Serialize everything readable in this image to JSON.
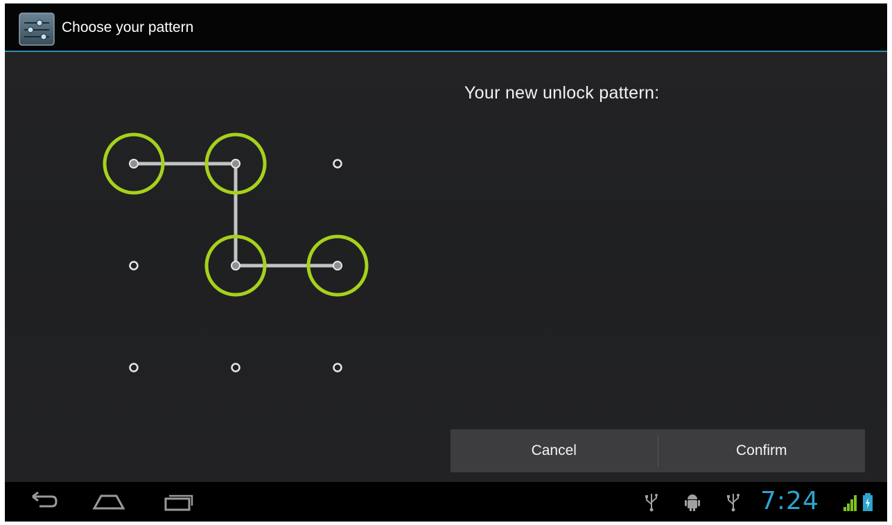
{
  "action_bar": {
    "title": "Choose your pattern",
    "icon": "settings-sliders-icon"
  },
  "pattern": {
    "grid_size": 3,
    "selected_sequence": [
      1,
      2,
      5,
      6
    ],
    "accent_color": "#a6d11b",
    "line_color": "#c4c4c4",
    "dot_color": "#e6e6e6"
  },
  "prompt": {
    "text": "Your new unlock pattern:"
  },
  "buttons": {
    "cancel_label": "Cancel",
    "confirm_label": "Confirm"
  },
  "nav_bar": {
    "back_icon": "back-arrow-icon",
    "home_icon": "home-icon",
    "recents_icon": "recent-apps-icon"
  },
  "status_bar": {
    "time": "7:24",
    "icons": [
      "usb-icon",
      "android-debug-icon",
      "usb-icon",
      "signal-icon",
      "battery-icon"
    ]
  }
}
